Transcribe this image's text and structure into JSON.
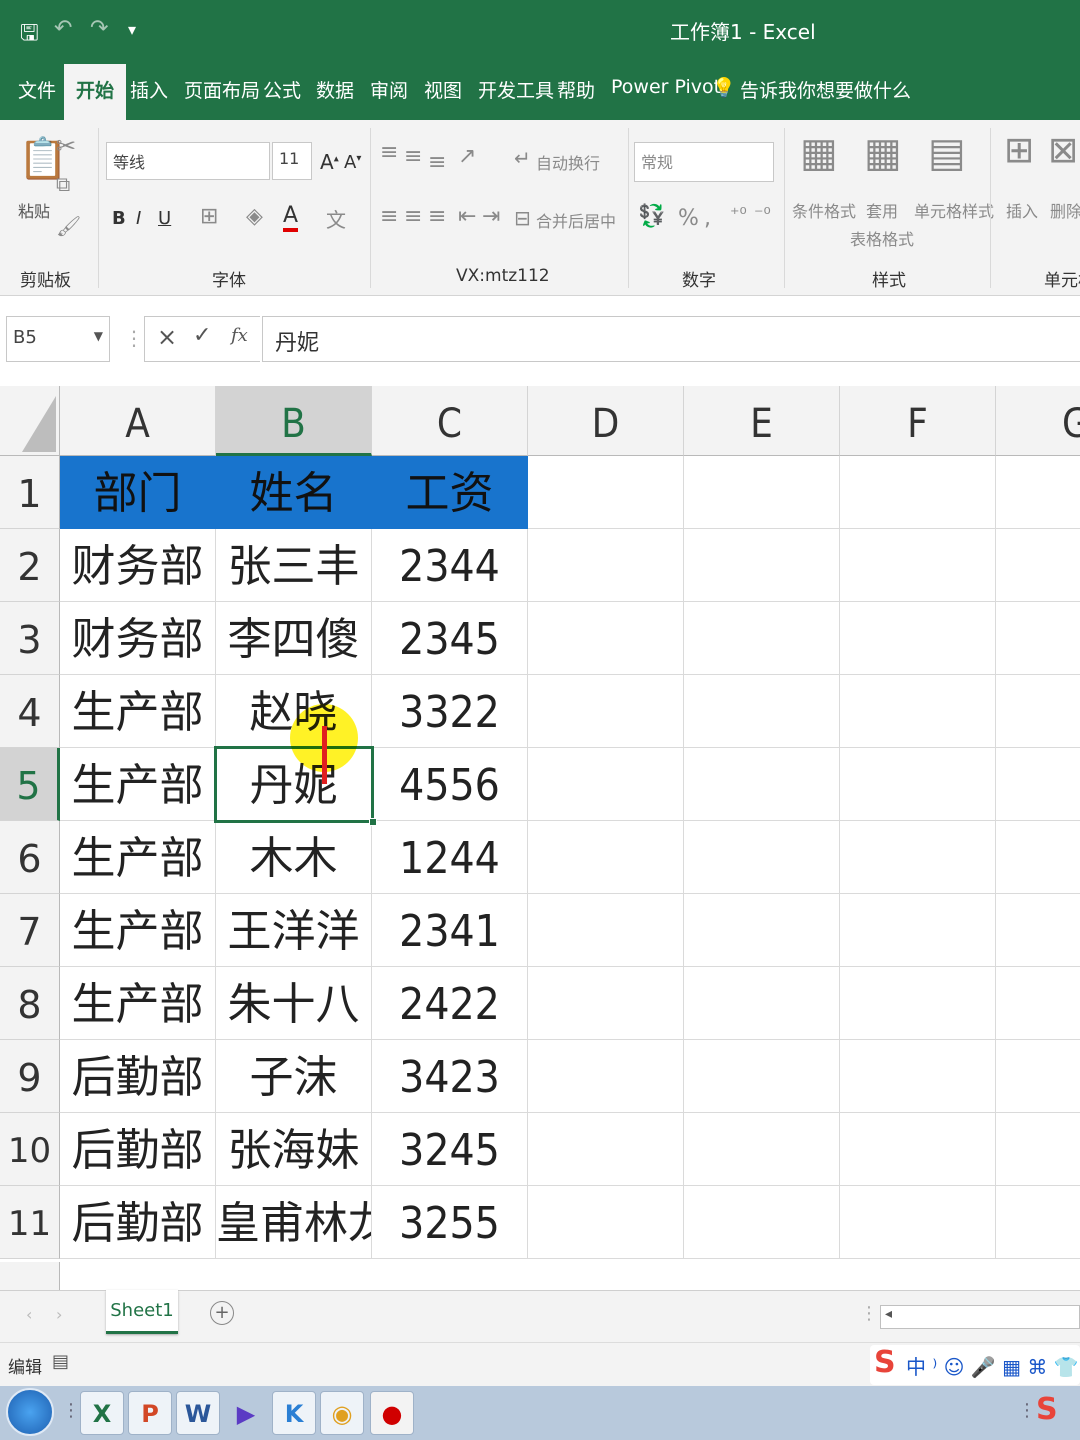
{
  "app": {
    "title": "工作簿1 - Excel"
  },
  "menu_tabs": [
    "文件",
    "开始",
    "插入",
    "页面布局",
    "公式",
    "数据",
    "审阅",
    "视图",
    "开发工具",
    "帮助",
    "Power Pivot"
  ],
  "tell_me": "告诉我你想要做什么",
  "ribbon": {
    "clipboard": {
      "paste": "粘贴",
      "group": "剪贴板"
    },
    "font": {
      "name": "等线",
      "size": "11",
      "bold": "B",
      "italic": "I",
      "underline": "U",
      "group": "字体"
    },
    "alignment": {
      "wrap": "自动换行",
      "merge": "合并后居中",
      "group": "VX:mtz112"
    },
    "number": {
      "format": "常规",
      "percent": "%",
      "comma": ",",
      "group": "数字"
    },
    "styles": {
      "conditional": "条件格式",
      "table_fmt_1": "套用",
      "table_fmt_2": "表格格式",
      "cell_style": "单元格样式",
      "group": "样式"
    },
    "cells": {
      "insert": "插入",
      "delete": "删除",
      "group": "单元格"
    }
  },
  "formula_bar": {
    "name_box": "B5",
    "cancel": "×",
    "enter": "✓",
    "fx": "fx",
    "content": "丹妮"
  },
  "columns": [
    "A",
    "B",
    "C",
    "D",
    "E",
    "F",
    "G"
  ],
  "rows": [
    {
      "n": "1",
      "a": "部门",
      "b": "姓名",
      "c": "工资"
    },
    {
      "n": "2",
      "a": "财务部",
      "b": "张三丰",
      "c": "2344"
    },
    {
      "n": "3",
      "a": "财务部",
      "b": "李四傻",
      "c": "2345"
    },
    {
      "n": "4",
      "a": "生产部",
      "b": "赵晓",
      "c": "3322"
    },
    {
      "n": "5",
      "a": "生产部",
      "b": "丹妮",
      "c": "4556"
    },
    {
      "n": "6",
      "a": "生产部",
      "b": "木木",
      "c": "1244"
    },
    {
      "n": "7",
      "a": "生产部",
      "b": "王洋洋",
      "c": "2341"
    },
    {
      "n": "8",
      "a": "生产部",
      "b": "朱十八",
      "c": "2422"
    },
    {
      "n": "9",
      "a": "后勤部",
      "b": "子沫",
      "c": "3423"
    },
    {
      "n": "10",
      "a": "后勤部",
      "b": "张海妹",
      "c": "3245"
    },
    {
      "n": "11",
      "a": "后勤部",
      "b": "皇甫林龙",
      "c": "3255"
    }
  ],
  "sheet_tab": "Sheet1",
  "status": {
    "mode": "编辑"
  },
  "colors": {
    "excel_green": "#217346",
    "header_fill": "#1874cd"
  }
}
